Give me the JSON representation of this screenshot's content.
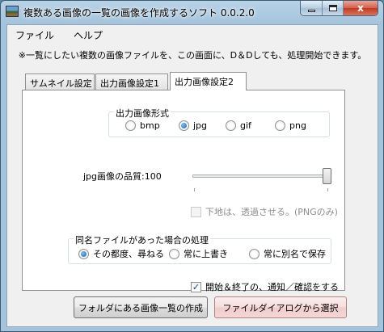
{
  "window": {
    "title": "複数ある画像の一覧の画像を作成するソフト 0.0.2.0",
    "close_glyph": "x"
  },
  "menu": {
    "file": "ファイル",
    "help": "ヘルプ"
  },
  "notice": "※一覧にしたい複数の画像ファイルを、この画面に、D＆Dしても、処理開始できます。",
  "tabs": [
    {
      "label": "サムネイル設定"
    },
    {
      "label": "出力画像設定1"
    },
    {
      "label": "出力画像設定2",
      "active": true
    }
  ],
  "output_format": {
    "title": "出力画像形式",
    "options": [
      "bmp",
      "jpg",
      "gif",
      "png"
    ],
    "selected": "jpg"
  },
  "jpg_quality": {
    "label": "jpg画像の品質:100",
    "value": 100,
    "max": 100
  },
  "transparent_bg": {
    "label": "下地は、透過させる。(PNGのみ)",
    "checked": false,
    "enabled": false
  },
  "same_name": {
    "title": "同名ファイルがあった場合の処理",
    "options": [
      "その都度、尋ねる",
      "常に上書き",
      "常に別名で保存"
    ],
    "selected": "その都度、尋ねる"
  },
  "notify": {
    "label": "開始＆終了の、通知／確認をする",
    "checked": true
  },
  "buttons": {
    "folder_list": "フォルダにある画像一覧の作成",
    "file_dialog": "ファイルダイアログから選択"
  },
  "colors": {
    "title_bar": "#a5c4dc",
    "close_button": "#c23a22",
    "hot_button": "#f4d6d6",
    "radio_accent": "#1a5fa8"
  }
}
